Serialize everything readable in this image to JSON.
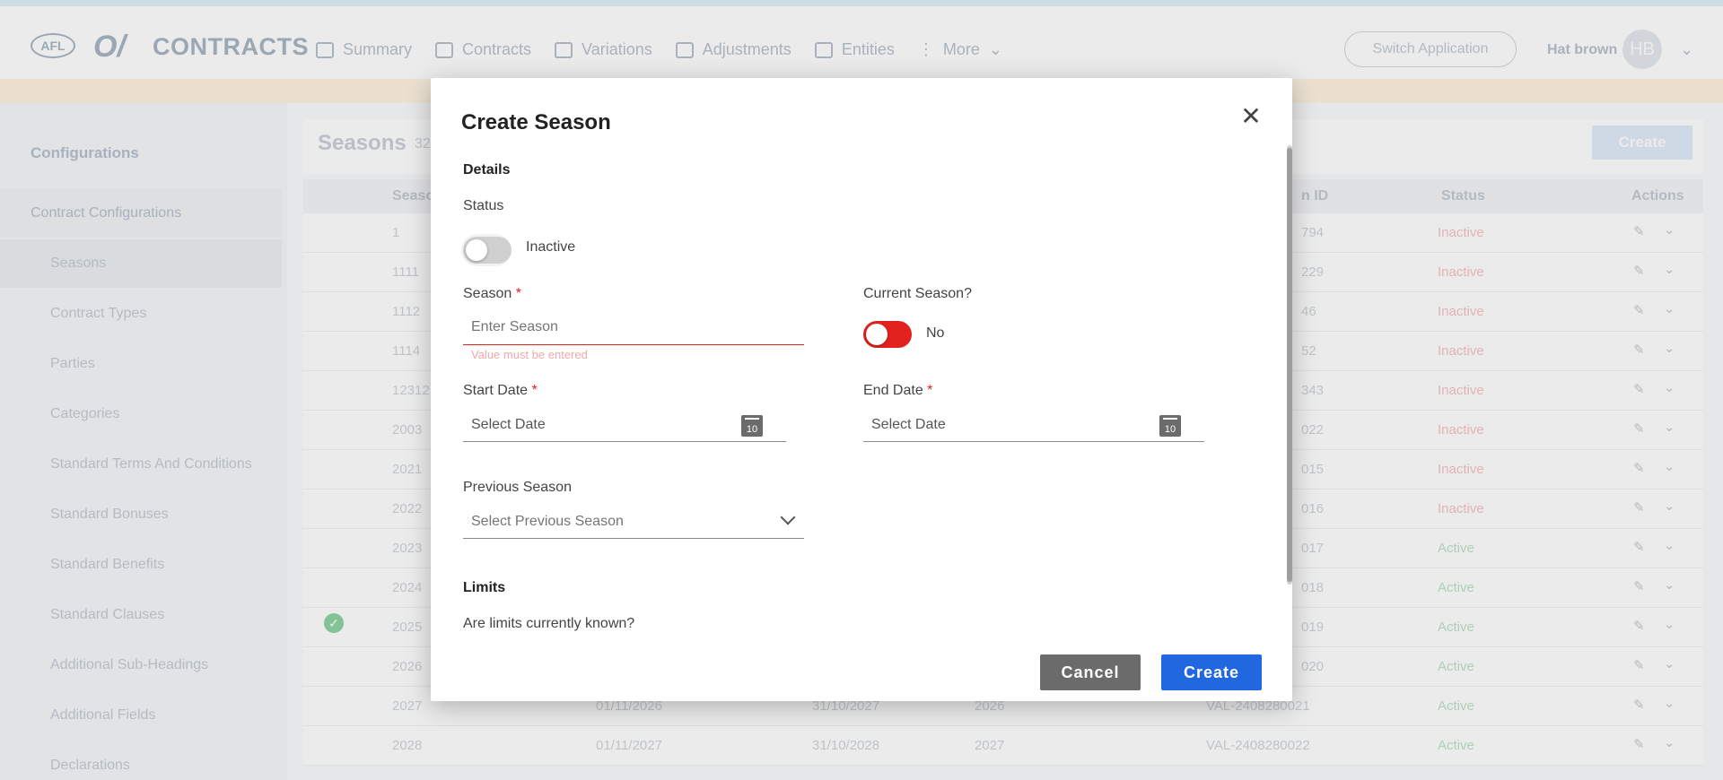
{
  "header": {
    "brand_logo": "AFL",
    "brand_mark": "O/",
    "app_title": "CONTRACTS",
    "nav": [
      {
        "label": "Summary",
        "icon": "folder-icon"
      },
      {
        "label": "Contracts",
        "icon": "document-add-icon"
      },
      {
        "label": "Variations",
        "icon": "document-edit-icon"
      },
      {
        "label": "Adjustments",
        "icon": "document-check-icon"
      },
      {
        "label": "Entities",
        "icon": "group-icon"
      },
      {
        "label": "More",
        "icon": "more-vertical-icon"
      }
    ],
    "switch_application": "Switch Application",
    "user_name": "Hat brown",
    "user_initials": "HB"
  },
  "sidebar": {
    "heading": "Configurations",
    "group": "Contract Configurations",
    "items": [
      "Seasons",
      "Contract Types",
      "Parties",
      "Categories",
      "Standard Terms And Conditions",
      "Standard Bonuses",
      "Standard Benefits",
      "Standard Clauses",
      "Additional Sub-Headings",
      "Additional Fields",
      "Declarations"
    ]
  },
  "background": {
    "page_title": "Seasons",
    "count": "32",
    "create_button": "Create",
    "columns": {
      "season": "Seaso",
      "validation_id": "n ID",
      "status": "Status",
      "actions": "Actions"
    },
    "rows": [
      {
        "season": "1",
        "start": "",
        "end": "",
        "prev": "",
        "id": "794",
        "status": "Inactive"
      },
      {
        "season": "1111",
        "start": "",
        "end": "",
        "prev": "",
        "id": "229",
        "status": "Inactive"
      },
      {
        "season": "1112",
        "start": "",
        "end": "",
        "prev": "",
        "id": "46",
        "status": "Inactive"
      },
      {
        "season": "1114",
        "start": "",
        "end": "",
        "prev": "",
        "id": "52",
        "status": "Inactive"
      },
      {
        "season": "12312",
        "start": "",
        "end": "",
        "prev": "",
        "id": "343",
        "status": "Inactive"
      },
      {
        "season": "2003",
        "start": "",
        "end": "",
        "prev": "",
        "id": "022",
        "status": "Inactive"
      },
      {
        "season": "2021",
        "start": "",
        "end": "",
        "prev": "",
        "id": "015",
        "status": "Inactive"
      },
      {
        "season": "2022",
        "start": "",
        "end": "",
        "prev": "",
        "id": "016",
        "status": "Inactive"
      },
      {
        "season": "2023",
        "start": "",
        "end": "",
        "prev": "",
        "id": "017",
        "status": "Active"
      },
      {
        "season": "2024",
        "start": "",
        "end": "",
        "prev": "",
        "id": "018",
        "status": "Active"
      },
      {
        "season": "2025",
        "start": "",
        "end": "",
        "prev": "",
        "id": "019",
        "status": "Active"
      },
      {
        "season": "2026",
        "start": "",
        "end": "",
        "prev": "",
        "id": "020",
        "status": "Active"
      },
      {
        "season": "2027",
        "start": "01/11/2026",
        "end": "31/10/2027",
        "prev": "2026",
        "id": "VAL-2408280021",
        "status": "Active"
      },
      {
        "season": "2028",
        "start": "01/11/2027",
        "end": "31/10/2028",
        "prev": "2027",
        "id": "VAL-2408280022",
        "status": "Active"
      }
    ]
  },
  "dialog": {
    "title": "Create Season",
    "details_heading": "Details",
    "status_label": "Status",
    "status_value": "Inactive",
    "season_label": "Season",
    "season_placeholder": "Enter Season",
    "season_error": "Value must be entered",
    "current_season_label": "Current Season?",
    "current_season_value": "No",
    "start_date_label": "Start Date",
    "start_date_placeholder": "Select Date",
    "end_date_label": "End Date",
    "end_date_placeholder": "Select Date",
    "calendar_glyph": "10",
    "previous_season_label": "Previous Season",
    "previous_season_placeholder": "Select Previous Season",
    "limits_heading": "Limits",
    "limits_question": "Are limits currently known?",
    "required_marker": "*",
    "close_glyph": "✕",
    "cancel_label": "Cancel",
    "create_label": "Create"
  },
  "colors": {
    "primary": "#2167e0",
    "danger": "#e2221e",
    "neutral_button": "#6b6b6b"
  }
}
